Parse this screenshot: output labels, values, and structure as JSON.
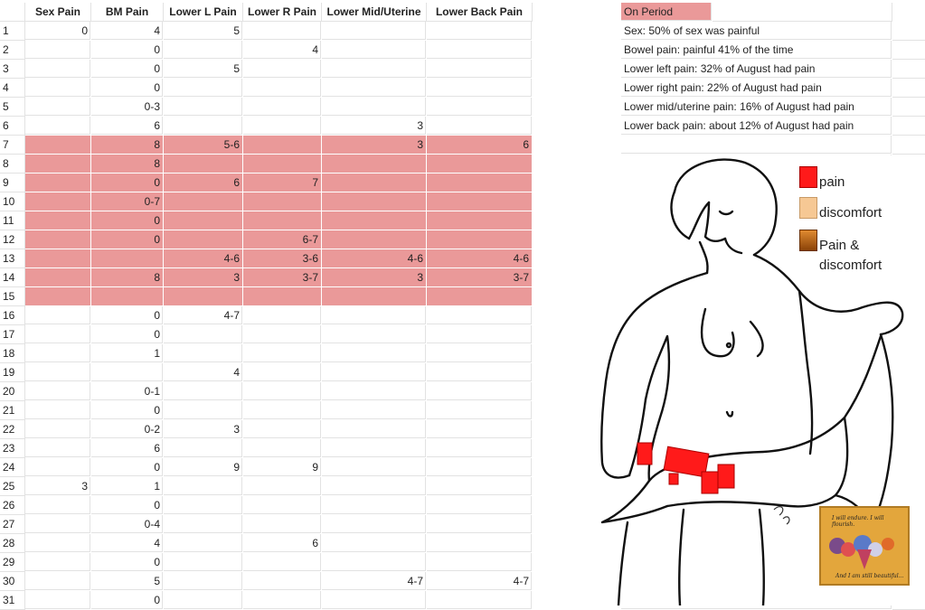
{
  "headers": [
    "Sex Pain",
    "BM Pain",
    "Lower L Pain",
    "Lower R Pain",
    "Lower Mid/Uterine",
    "Lower Back Pain"
  ],
  "period_label": "On  Period",
  "notes": [
    "Sex: 50% of sex was painful",
    "Bowel pain: painful 41% of the time",
    "Lower left pain:  32% of August had pain",
    "Lower right pain: 22% of August had pain",
    "Lower mid/uterine pain: 16% of August had pain",
    "Lower back pain: about 12% of August had pain"
  ],
  "rows": [
    {
      "n": "1",
      "sex": "0",
      "bm": "4",
      "ll": "5",
      "lr": "",
      "mid": "",
      "back": "",
      "period": false
    },
    {
      "n": "2",
      "sex": "",
      "bm": "0",
      "ll": "",
      "lr": "4",
      "mid": "",
      "back": "",
      "period": false
    },
    {
      "n": "3",
      "sex": "",
      "bm": "0",
      "ll": "5",
      "lr": "",
      "mid": "",
      "back": "",
      "period": false
    },
    {
      "n": "4",
      "sex": "",
      "bm": "0",
      "ll": "",
      "lr": "",
      "mid": "",
      "back": "",
      "period": false
    },
    {
      "n": "5",
      "sex": "",
      "bm": "0-3",
      "ll": "",
      "lr": "",
      "mid": "",
      "back": "",
      "period": false
    },
    {
      "n": "6",
      "sex": "",
      "bm": "6",
      "ll": "",
      "lr": "",
      "mid": "3",
      "back": "",
      "period": false
    },
    {
      "n": "7",
      "sex": "",
      "bm": "8",
      "ll": "5-6",
      "lr": "",
      "mid": "3",
      "back": "6",
      "period": true
    },
    {
      "n": "8",
      "sex": "",
      "bm": "8",
      "ll": "",
      "lr": "",
      "mid": "",
      "back": "",
      "period": true
    },
    {
      "n": "9",
      "sex": "",
      "bm": "0",
      "ll": "6",
      "lr": "7",
      "mid": "",
      "back": "",
      "period": true
    },
    {
      "n": "10",
      "sex": "",
      "bm": "0-7",
      "ll": "",
      "lr": "",
      "mid": "",
      "back": "",
      "period": true
    },
    {
      "n": "11",
      "sex": "",
      "bm": "0",
      "ll": "",
      "lr": "",
      "mid": "",
      "back": "",
      "period": true
    },
    {
      "n": "12",
      "sex": "",
      "bm": "0",
      "ll": "",
      "lr": "6-7",
      "mid": "",
      "back": "",
      "period": true
    },
    {
      "n": "13",
      "sex": "",
      "bm": "",
      "ll": "4-6",
      "lr": "3-6",
      "mid": "4-6",
      "back": "4-6",
      "period": true
    },
    {
      "n": "14",
      "sex": "",
      "bm": "8",
      "ll": "3",
      "lr": "3-7",
      "mid": "3",
      "back": "3-7",
      "period": true
    },
    {
      "n": "15",
      "sex": "",
      "bm": "",
      "ll": "",
      "lr": "",
      "mid": "",
      "back": "",
      "period": true
    },
    {
      "n": "16",
      "sex": "",
      "bm": "0",
      "ll": "4-7",
      "lr": "",
      "mid": "",
      "back": "",
      "period": false
    },
    {
      "n": "17",
      "sex": "",
      "bm": "0",
      "ll": "",
      "lr": "",
      "mid": "",
      "back": "",
      "period": false
    },
    {
      "n": "18",
      "sex": "",
      "bm": "1",
      "ll": "",
      "lr": "",
      "mid": "",
      "back": "",
      "period": false
    },
    {
      "n": "19",
      "sex": "",
      "bm": "",
      "ll": "4",
      "lr": "",
      "mid": "",
      "back": "",
      "period": false
    },
    {
      "n": "20",
      "sex": "",
      "bm": "0-1",
      "ll": "",
      "lr": "",
      "mid": "",
      "back": "",
      "period": false
    },
    {
      "n": "21",
      "sex": "",
      "bm": "0",
      "ll": "",
      "lr": "",
      "mid": "",
      "back": "",
      "period": false
    },
    {
      "n": "22",
      "sex": "",
      "bm": "0-2",
      "ll": "3",
      "lr": "",
      "mid": "",
      "back": "",
      "period": false
    },
    {
      "n": "23",
      "sex": "",
      "bm": "6",
      "ll": "",
      "lr": "",
      "mid": "",
      "back": "",
      "period": false
    },
    {
      "n": "24",
      "sex": "",
      "bm": "0",
      "ll": "9",
      "lr": "9",
      "mid": "",
      "back": "",
      "period": false
    },
    {
      "n": "25",
      "sex": "3",
      "bm": "1",
      "ll": "",
      "lr": "",
      "mid": "",
      "back": "",
      "period": false
    },
    {
      "n": "26",
      "sex": "",
      "bm": "0",
      "ll": "",
      "lr": "",
      "mid": "",
      "back": "",
      "period": false
    },
    {
      "n": "27",
      "sex": "",
      "bm": "0-4",
      "ll": "",
      "lr": "",
      "mid": "",
      "back": "",
      "period": false
    },
    {
      "n": "28",
      "sex": "",
      "bm": "4",
      "ll": "",
      "lr": "6",
      "mid": "",
      "back": "",
      "period": false
    },
    {
      "n": "29",
      "sex": "",
      "bm": "0",
      "ll": "",
      "lr": "",
      "mid": "",
      "back": "",
      "period": false
    },
    {
      "n": "30",
      "sex": "",
      "bm": "5",
      "ll": "",
      "lr": "",
      "mid": "4-7",
      "back": "4-7",
      "period": false
    },
    {
      "n": "31",
      "sex": "",
      "bm": "0",
      "ll": "",
      "lr": "",
      "mid": "",
      "back": "",
      "period": false
    }
  ],
  "legend": {
    "pain": "pain",
    "discomfort": "discomfort",
    "both_line1": "Pain &",
    "both_line2": "discomfort",
    "pain_color": "#ff1a1a",
    "discomfort_color": "#f6c894",
    "both_color": "#b65a10"
  },
  "stamp": {
    "line1": "I will endure.  I will flourish.",
    "line2": "And I am still beautiful..."
  },
  "colors": {
    "period_highlight": "#ea9999",
    "grid": "#e2e2e2"
  }
}
